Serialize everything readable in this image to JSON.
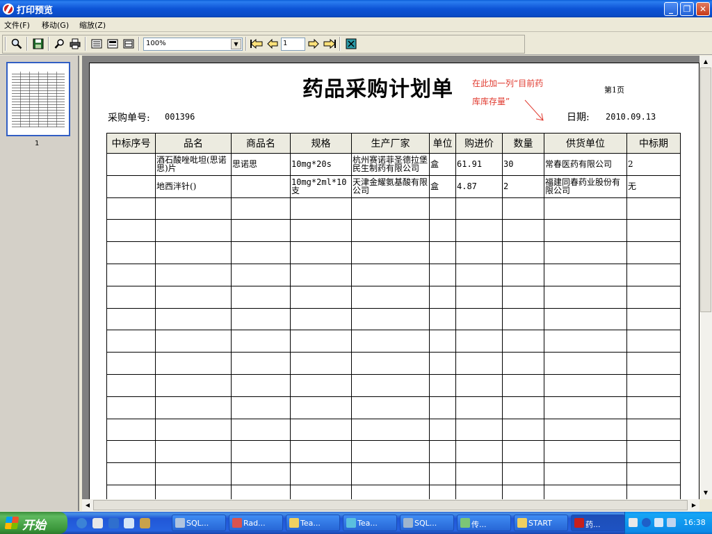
{
  "window": {
    "title": "打印预览",
    "minimize_glyph": "_",
    "restore_glyph": "❐",
    "close_glyph": "✕"
  },
  "menu": [
    {
      "label": "文件(F)"
    },
    {
      "label": "移动(G)"
    },
    {
      "label": "缩放(Z)"
    }
  ],
  "toolbar": {
    "buttons": [
      {
        "name": "zoom-icon"
      },
      {
        "name": "save-icon"
      },
      {
        "name": "find-icon"
      },
      {
        "name": "print-icon"
      },
      {
        "name": "single-page-icon"
      },
      {
        "name": "two-page-icon"
      },
      {
        "name": "multi-page-icon"
      },
      {
        "name": "first-page-icon"
      },
      {
        "name": "previous-page-icon"
      },
      {
        "name": "next-page-icon"
      },
      {
        "name": "last-page-icon"
      },
      {
        "name": "close-preview-icon"
      }
    ],
    "zoom_value": "100%",
    "page_value": "1"
  },
  "thumbnails": {
    "page_label": "1"
  },
  "document": {
    "title": "药品采购计划单",
    "page_label": "第1页",
    "annotation_line1": "在此加一列“目前药",
    "annotation_line2": "库库存量”",
    "po_label": "采购单号:",
    "po_number": "001396",
    "date_label": "日期:",
    "date_value": "2010.09.13",
    "table": {
      "headers": [
        "中标序号",
        "品名",
        "商品名",
        "规格",
        "生产厂家",
        "单位",
        "购进价",
        "数量",
        "供货单位",
        "中标期"
      ],
      "rows": [
        [
          "",
          "酒石酸唑吡坦(思诺思)片",
          "思诺思",
          "10mg*20s",
          "杭州赛诺菲圣德拉堡民生制药有限公司",
          "盒",
          "61.91",
          "30",
          "常春医药有限公司",
          "2"
        ],
        [
          "",
          "地西泮针()",
          "",
          "10mg*2ml*10支",
          "天津金耀氨基酸有限公司",
          "盒",
          "4.87",
          "2",
          "福建同春药业股份有限公司",
          "无"
        ],
        [
          "",
          "",
          "",
          "",
          "",
          "",
          "",
          "",
          "",
          ""
        ],
        [
          "",
          "",
          "",
          "",
          "",
          "",
          "",
          "",
          "",
          ""
        ],
        [
          "",
          "",
          "",
          "",
          "",
          "",
          "",
          "",
          "",
          ""
        ],
        [
          "",
          "",
          "",
          "",
          "",
          "",
          "",
          "",
          "",
          ""
        ],
        [
          "",
          "",
          "",
          "",
          "",
          "",
          "",
          "",
          "",
          ""
        ],
        [
          "",
          "",
          "",
          "",
          "",
          "",
          "",
          "",
          "",
          ""
        ],
        [
          "",
          "",
          "",
          "",
          "",
          "",
          "",
          "",
          "",
          ""
        ],
        [
          "",
          "",
          "",
          "",
          "",
          "",
          "",
          "",
          "",
          ""
        ],
        [
          "",
          "",
          "",
          "",
          "",
          "",
          "",
          "",
          "",
          ""
        ],
        [
          "",
          "",
          "",
          "",
          "",
          "",
          "",
          "",
          "",
          ""
        ],
        [
          "",
          "",
          "",
          "",
          "",
          "",
          "",
          "",
          "",
          ""
        ],
        [
          "",
          "",
          "",
          "",
          "",
          "",
          "",
          "",
          "",
          ""
        ],
        [
          "",
          "",
          "",
          "",
          "",
          "",
          "",
          "",
          "",
          ""
        ],
        [
          "",
          "",
          "",
          "",
          "",
          "",
          "",
          "",
          "",
          ""
        ]
      ]
    }
  },
  "taskbar": {
    "start_label": "开始",
    "tasks": [
      {
        "label": "SQL...",
        "icon_color": "#b0c4de",
        "active": false
      },
      {
        "label": "Rad...",
        "icon_color": "#d9534f",
        "active": false
      },
      {
        "label": "Tea...",
        "icon_color": "#f0d060",
        "active": false
      },
      {
        "label": "Tea...",
        "icon_color": "#5bc0de",
        "active": false
      },
      {
        "label": "SQL...",
        "icon_color": "#9fb6cd",
        "active": false
      },
      {
        "label": "传...",
        "icon_color": "#7cc576",
        "active": false
      },
      {
        "label": "START",
        "icon_color": "#f0d060",
        "active": false
      },
      {
        "label": "药...",
        "icon_color": "#c8201c",
        "active": true
      }
    ],
    "clock": "16:38"
  }
}
